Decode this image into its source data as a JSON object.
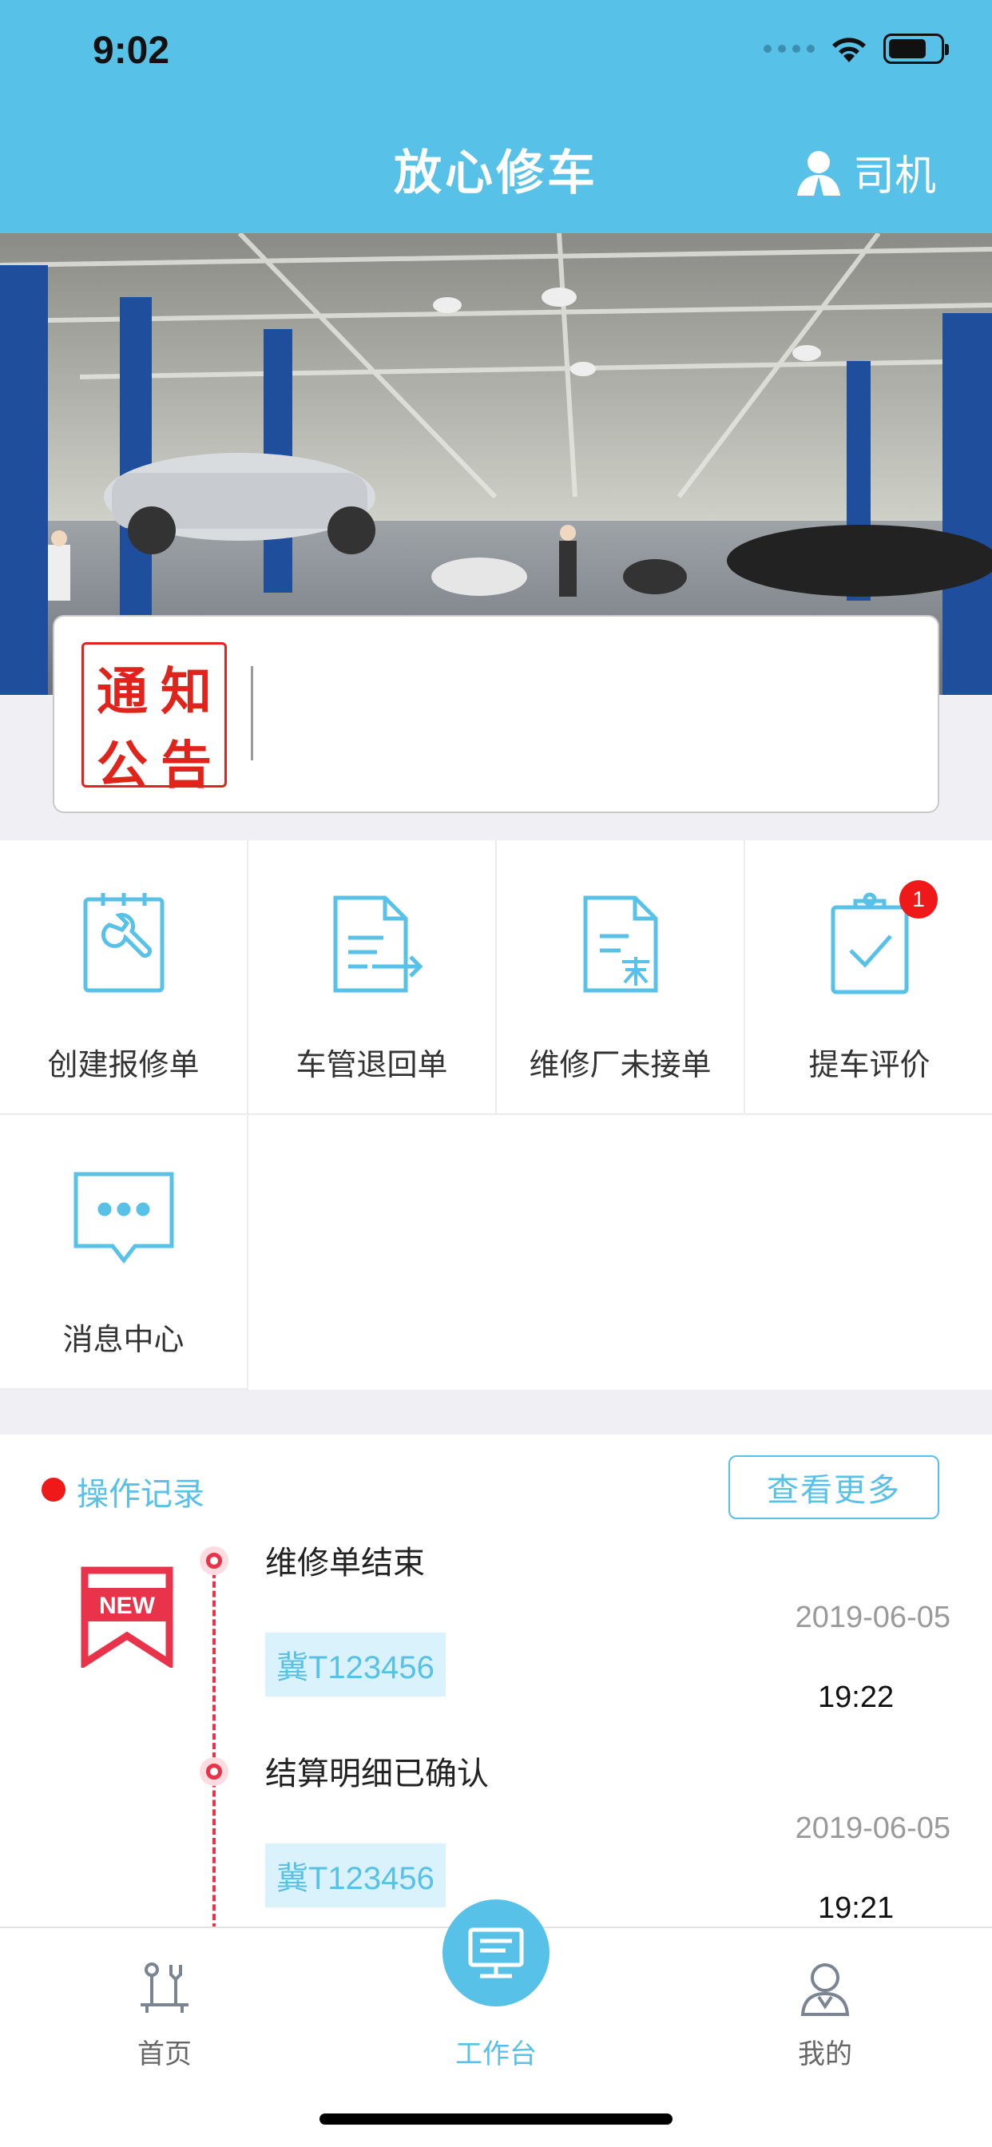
{
  "status_bar": {
    "time": "9:02"
  },
  "header": {
    "title": "放心修车",
    "role_label": "司机"
  },
  "notice": {
    "badge_chars": [
      "通",
      "知",
      "公",
      "告"
    ]
  },
  "functions": [
    {
      "label": "创建报修单",
      "icon": "wrench-document-icon"
    },
    {
      "label": "车管退回单",
      "icon": "return-document-icon"
    },
    {
      "label": "维修厂未接单",
      "icon": "unaccepted-document-icon"
    },
    {
      "label": "提车评价",
      "icon": "clipboard-check-icon",
      "badge": "1"
    },
    {
      "label": "消息中心",
      "icon": "chat-bubble-icon"
    }
  ],
  "records": {
    "title": "操作记录",
    "more_label": "查看更多",
    "new_label": "NEW",
    "items": [
      {
        "event": "维修单结束",
        "plate": "冀T123456",
        "date": "2019-06-05",
        "time": "19:22"
      },
      {
        "event": "结算明细已确认",
        "plate": "冀T123456",
        "date": "2019-06-05",
        "time": "19:21"
      }
    ]
  },
  "tabbar": {
    "tabs": [
      {
        "label": "首页",
        "icon": "home-tools-icon"
      },
      {
        "label": "工作台",
        "icon": "workbench-monitor-icon",
        "active": true
      },
      {
        "label": "我的",
        "icon": "profile-icon"
      }
    ]
  },
  "colors": {
    "primary": "#57c1e8",
    "alert": "#f01919",
    "timeline": "#e8334a"
  }
}
